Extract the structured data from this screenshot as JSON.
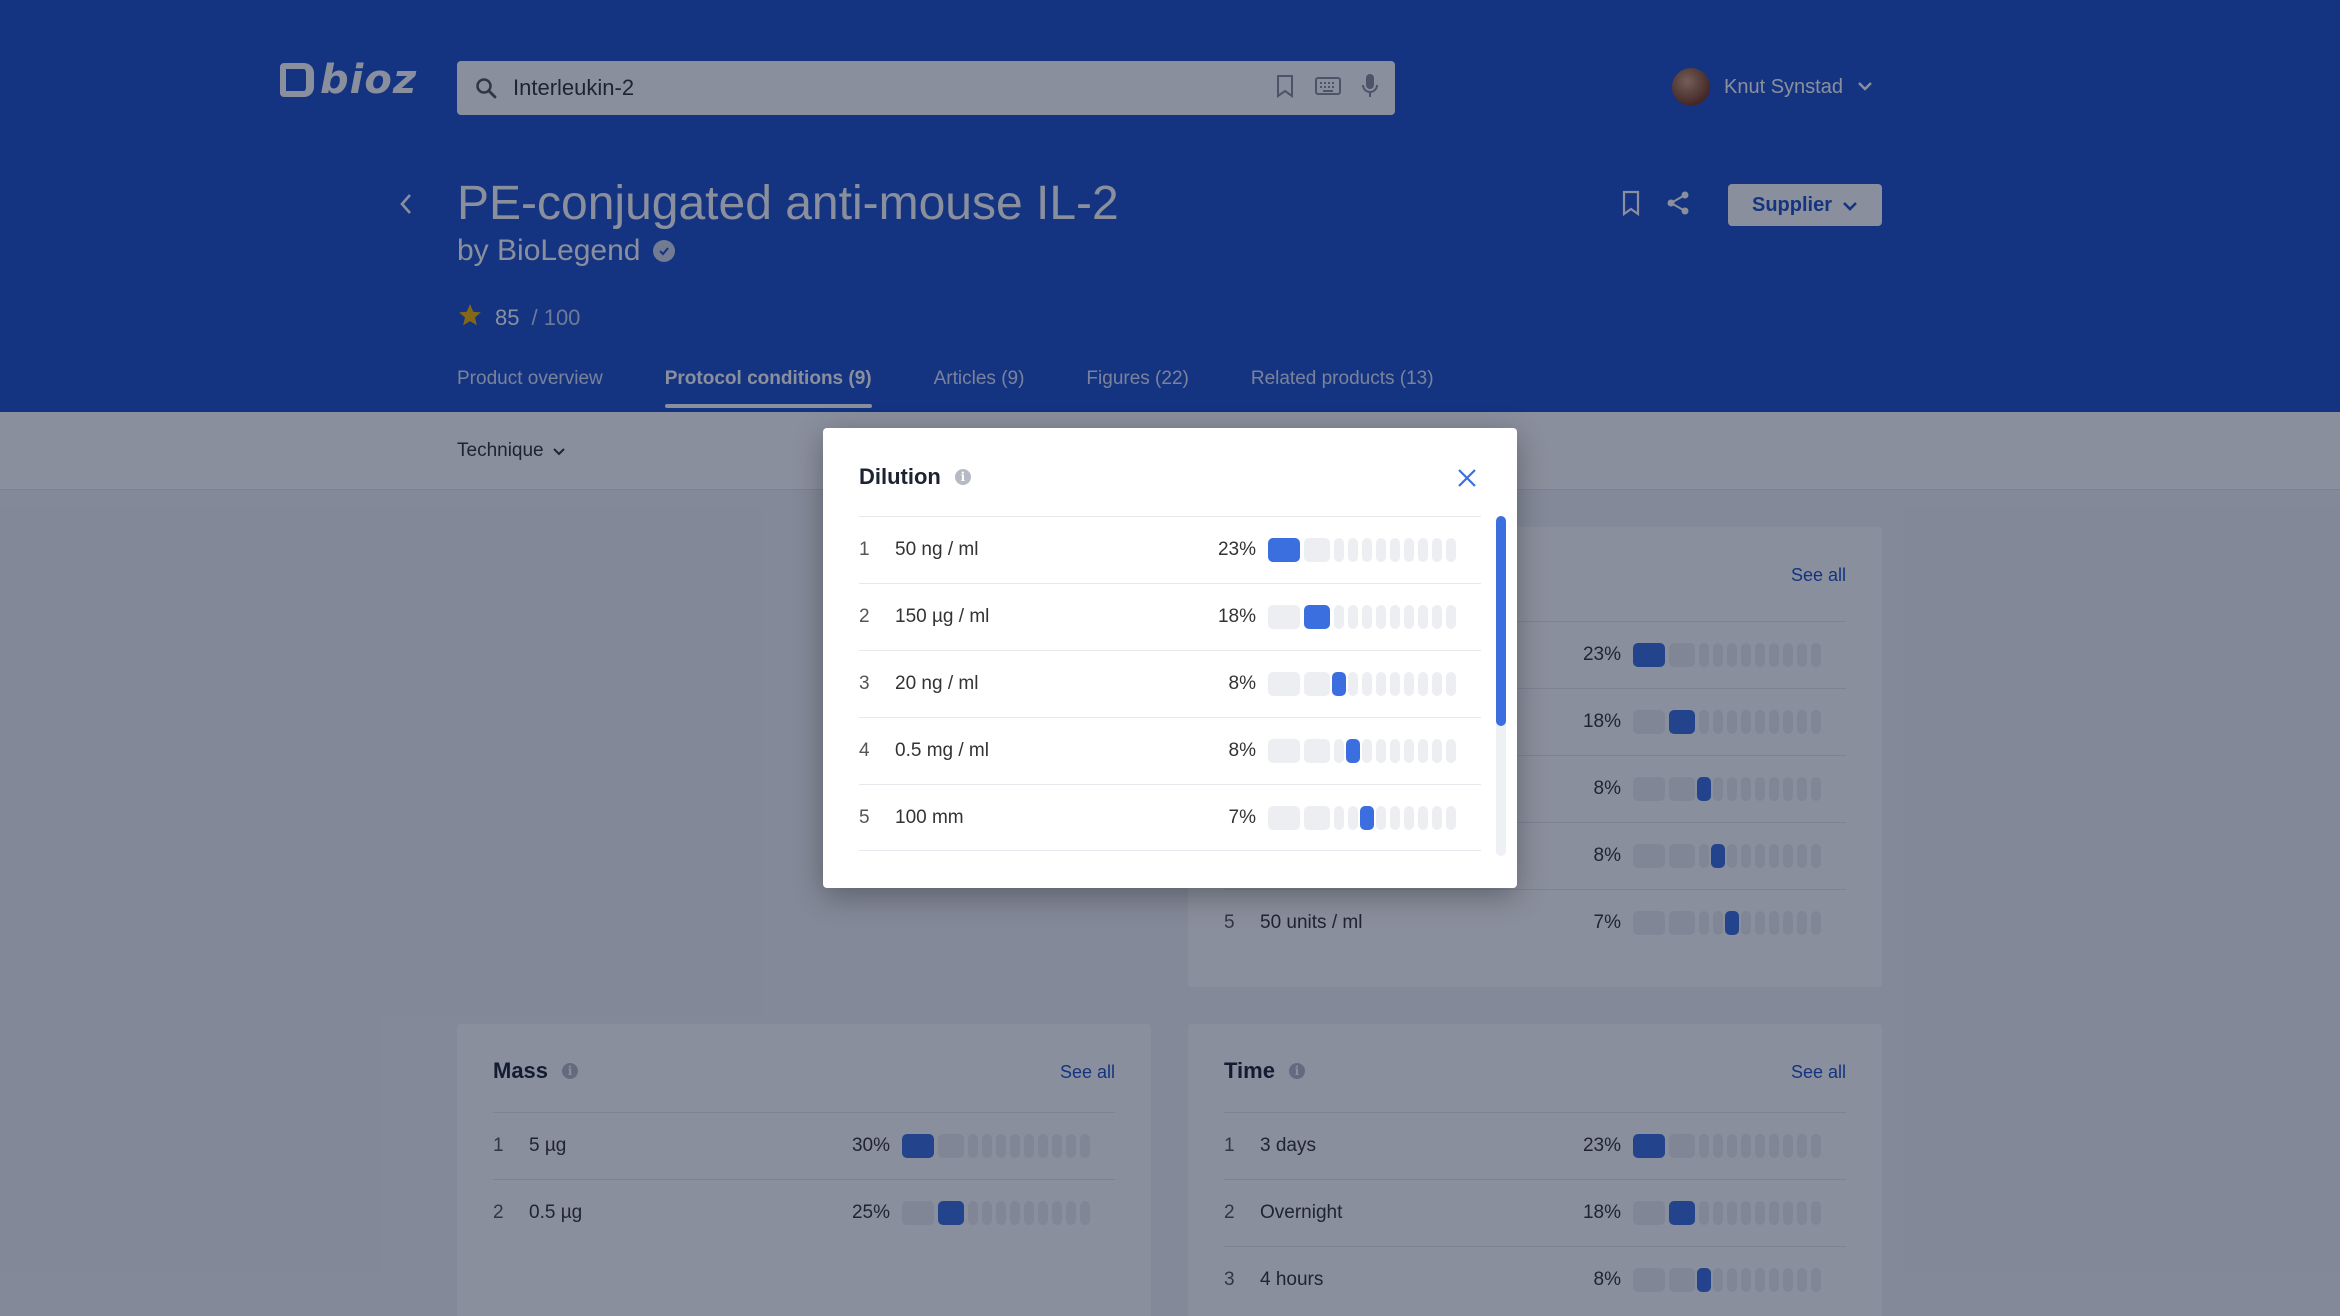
{
  "brand": {
    "logo_text": "bioz"
  },
  "search": {
    "value": "Interleukin-2"
  },
  "user": {
    "name": "Knut Synstad"
  },
  "product": {
    "title": "PE-conjugated anti-mouse IL-2",
    "byline": "by BioLegend",
    "score": "85",
    "score_max": "/ 100"
  },
  "supplier_button": "Supplier",
  "tabs": [
    {
      "label": "Product overview",
      "active": false
    },
    {
      "label": "Protocol conditions (9)",
      "active": true
    },
    {
      "label": "Articles (9)",
      "active": false
    },
    {
      "label": "Figures (22)",
      "active": false
    },
    {
      "label": "Related products (13)",
      "active": false
    }
  ],
  "filter": {
    "technique_label": "Technique"
  },
  "cards": {
    "right_top": {
      "see_all": "See all",
      "rows": [
        {
          "num": "1",
          "label": "",
          "pct": "23%",
          "rank": 1
        },
        {
          "num": "2",
          "label": "",
          "pct": "18%",
          "rank": 2
        },
        {
          "num": "3",
          "label": "",
          "pct": "8%",
          "rank": 3
        },
        {
          "num": "4",
          "label": "",
          "pct": "8%",
          "rank": 4
        },
        {
          "num": "5",
          "label": "50 units / ml",
          "pct": "7%",
          "rank": 5
        }
      ]
    },
    "mass": {
      "title": "Mass",
      "see_all": "See all",
      "rows": [
        {
          "num": "1",
          "label": "5 µg",
          "pct": "30%",
          "rank": 1
        },
        {
          "num": "2",
          "label": "0.5 µg",
          "pct": "25%",
          "rank": 2
        }
      ]
    },
    "time": {
      "title": "Time",
      "see_all": "See all",
      "rows": [
        {
          "num": "1",
          "label": "3 days",
          "pct": "23%",
          "rank": 1
        },
        {
          "num": "2",
          "label": "Overnight",
          "pct": "18%",
          "rank": 2
        },
        {
          "num": "3",
          "label": "4 hours",
          "pct": "8%",
          "rank": 3
        }
      ]
    }
  },
  "modal": {
    "title": "Dilution",
    "rows": [
      {
        "num": "1",
        "label": "50 ng / ml",
        "pct": "23%",
        "rank": 1
      },
      {
        "num": "2",
        "label": "150 µg / ml",
        "pct": "18%",
        "rank": 2
      },
      {
        "num": "3",
        "label": "20 ng / ml",
        "pct": "8%",
        "rank": 3
      },
      {
        "num": "4",
        "label": "0.5 mg / ml",
        "pct": "8%",
        "rank": 4
      },
      {
        "num": "5",
        "label": "100 mm",
        "pct": "7%",
        "rank": 5
      }
    ]
  },
  "colors": {
    "header_bg": "#1e50c8",
    "accent": "#3b6fe0",
    "rating_star": "#f4b400"
  },
  "icons": [
    "search-icon",
    "bookmark-icon",
    "keyboard-icon",
    "microphone-icon",
    "chevron-down-icon",
    "back-icon",
    "verified-icon",
    "star-icon",
    "share-icon",
    "info-icon",
    "close-icon"
  ]
}
